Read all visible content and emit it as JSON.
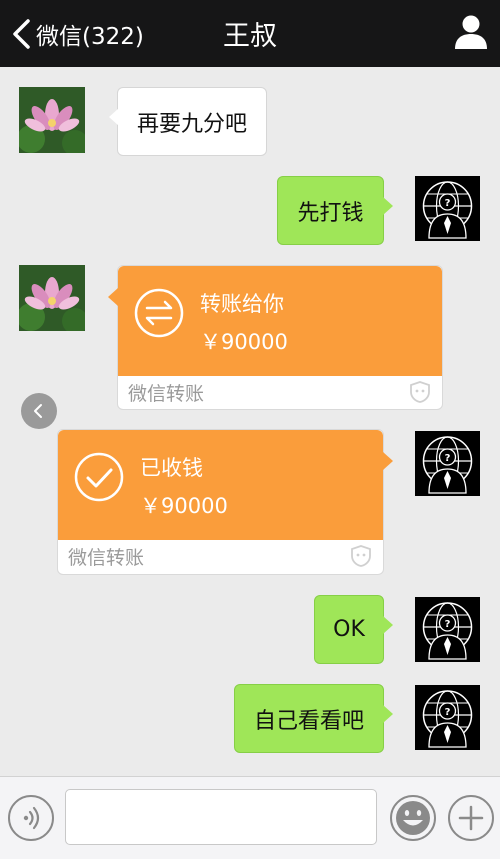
{
  "header": {
    "back_label": "微信(322)",
    "title": "王叔"
  },
  "messages": [
    {
      "side": "left",
      "type": "text",
      "text": "再要九分吧"
    },
    {
      "side": "right",
      "type": "text",
      "text": "先打钱"
    },
    {
      "side": "left",
      "type": "transfer",
      "title": "转账给你",
      "amount": "￥90000",
      "footer": "微信转账"
    },
    {
      "side": "right",
      "type": "transfer",
      "title": "已收钱",
      "amount": "￥90000",
      "footer": "微信转账"
    },
    {
      "side": "right",
      "type": "text",
      "text": "OK"
    },
    {
      "side": "right",
      "type": "text",
      "text": "自己看看吧"
    }
  ],
  "input": {
    "value": ""
  },
  "colors": {
    "header_bg": "#161617",
    "chat_bg": "#ebebeb",
    "sent_bubble": "#9fe658",
    "received_bubble": "#ffffff",
    "transfer_orange": "#fa9d3b"
  },
  "icons": {
    "back": "chevron-left-icon",
    "profile": "person-icon",
    "transfer_send": "exchange-arrows-icon",
    "transfer_received": "check-circle-icon",
    "collapse": "chevron-left-icon",
    "voice": "voice-icon",
    "emoji": "smiley-icon",
    "more": "plus-icon"
  }
}
